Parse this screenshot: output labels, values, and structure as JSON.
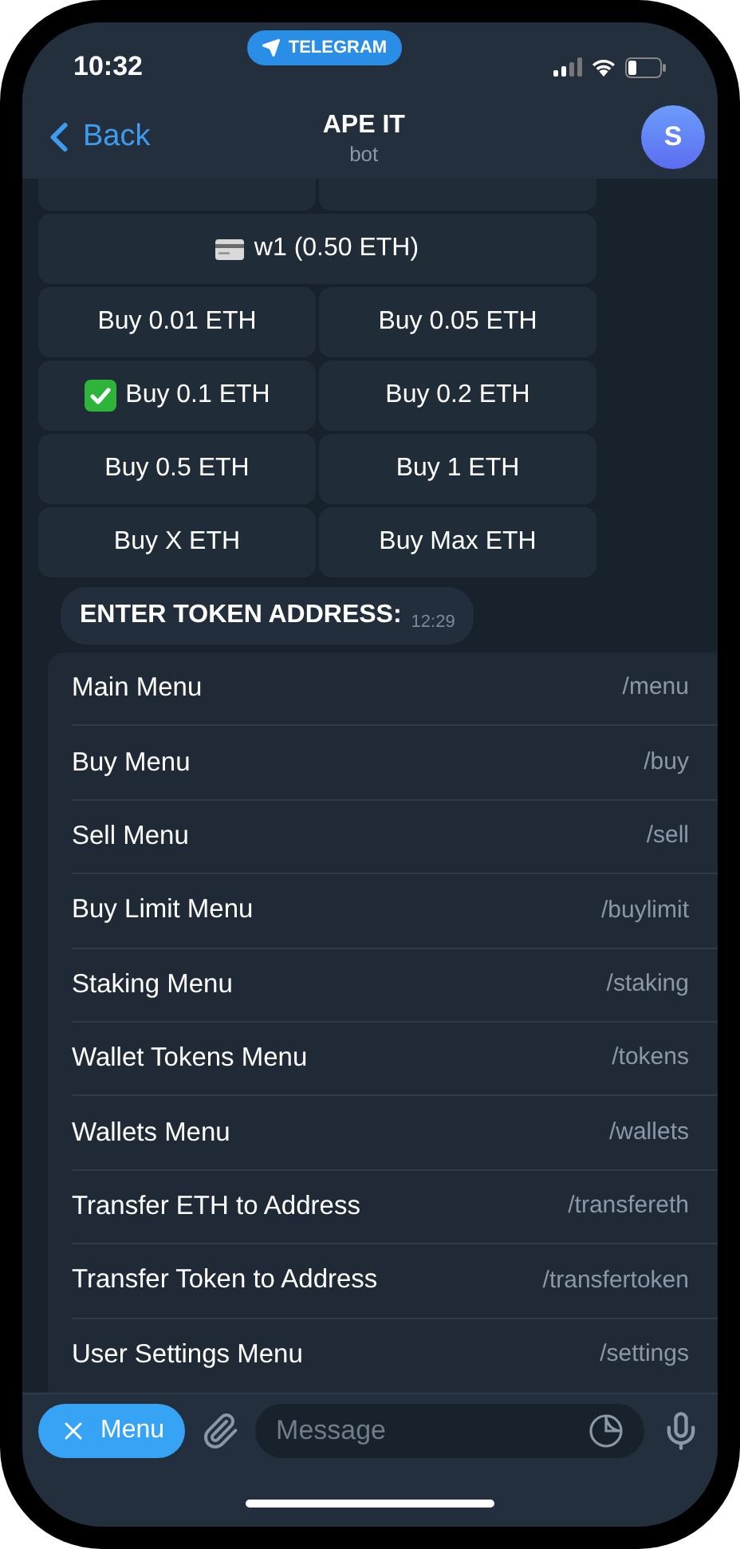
{
  "status_bar": {
    "time": "10:32",
    "app_pill": "TELEGRAM"
  },
  "header": {
    "back": "Back",
    "title": "APE IT",
    "subtitle": "bot",
    "avatar": "S"
  },
  "keyboard": {
    "wallet": "w1 (0.50 ETH)",
    "buy_buttons": [
      {
        "label": "Buy 0.01 ETH",
        "checked": false
      },
      {
        "label": "Buy 0.05 ETH",
        "checked": false
      },
      {
        "label": "Buy 0.1 ETH",
        "checked": true
      },
      {
        "label": "Buy 0.2 ETH",
        "checked": false
      },
      {
        "label": "Buy 0.5 ETH",
        "checked": false
      },
      {
        "label": "Buy 1 ETH",
        "checked": false
      },
      {
        "label": "Buy X ETH",
        "checked": false
      },
      {
        "label": "Buy Max ETH",
        "checked": false
      }
    ]
  },
  "message": {
    "text": "ENTER TOKEN ADDRESS:",
    "time": "12:29"
  },
  "commands": [
    {
      "label": "Main Menu",
      "command": "/menu"
    },
    {
      "label": "Buy Menu",
      "command": "/buy"
    },
    {
      "label": "Sell Menu",
      "command": "/sell"
    },
    {
      "label": "Buy Limit Menu",
      "command": "/buylimit"
    },
    {
      "label": "Staking Menu",
      "command": "/staking"
    },
    {
      "label": "Wallet Tokens Menu",
      "command": "/tokens"
    },
    {
      "label": "Wallets Menu",
      "command": "/wallets"
    },
    {
      "label": "Transfer ETH to Address",
      "command": "/transfereth"
    },
    {
      "label": "Transfer Token to Address",
      "command": "/transfertoken"
    },
    {
      "label": "User Settings Menu",
      "command": "/settings"
    }
  ],
  "input_bar": {
    "menu_button": "Menu",
    "placeholder": "Message"
  }
}
